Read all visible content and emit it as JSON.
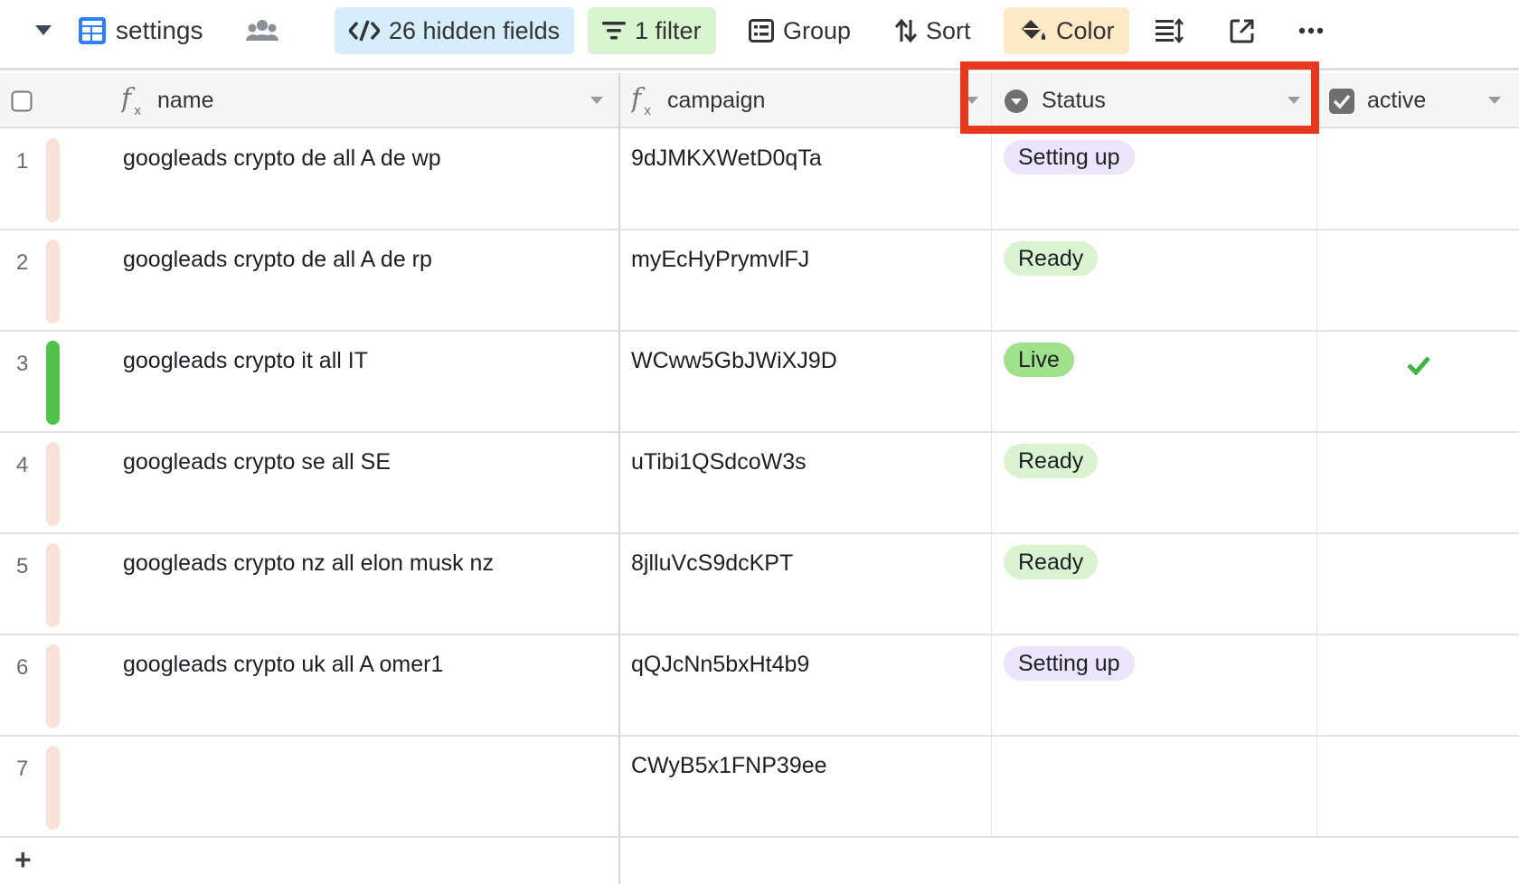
{
  "toolbar": {
    "view_name": "settings",
    "hidden_fields_label": "26 hidden fields",
    "filter_label": "1 filter",
    "group_label": "Group",
    "sort_label": "Sort",
    "color_label": "Color",
    "icons": [
      "chevron-down-icon",
      "grid-view-icon",
      "collaborators-icon",
      "hidden-fields-icon",
      "filter-icon",
      "group-icon",
      "sort-icon",
      "paint-bucket-icon",
      "row-height-icon",
      "share-view-icon",
      "more-icon"
    ]
  },
  "columns": [
    {
      "label": "name",
      "icon": "formula-icon"
    },
    {
      "label": "campaign",
      "icon": "formula-icon"
    },
    {
      "label": "Status",
      "icon": "single-select-icon"
    },
    {
      "label": "active",
      "icon": "checkbox-icon"
    }
  ],
  "rows": [
    {
      "num": "1",
      "name": "googleads crypto de all A  de wp",
      "campaign": "9dJMKXWetD0qTa",
      "status": "Setting up",
      "active": false,
      "color": "#f9e3d8"
    },
    {
      "num": "2",
      "name": "googleads crypto de all A  de rp",
      "campaign": "myEcHyPrymvlFJ",
      "status": "Ready",
      "active": false,
      "color": "#f9e3d8"
    },
    {
      "num": "3",
      "name": "googleads crypto it all   IT",
      "campaign": "WCww5GbJWiXJ9D",
      "status": "Live",
      "active": true,
      "color": "#4fc34a"
    },
    {
      "num": "4",
      "name": "googleads crypto se all   SE",
      "campaign": "uTibi1QSdcoW3s",
      "status": "Ready",
      "active": false,
      "color": "#f9e3d8"
    },
    {
      "num": "5",
      "name": "googleads crypto nz all   elon musk nz",
      "campaign": "8jlluVcS9dcKPT",
      "status": "Ready",
      "active": false,
      "color": "#f9e3d8"
    },
    {
      "num": "6",
      "name": "googleads crypto uk all A  omer1",
      "campaign": "qQJcNn5bxHt4b9",
      "status": "Setting up",
      "active": false,
      "color": "#f9e3d8"
    },
    {
      "num": "7",
      "name": "",
      "campaign": "CWyB5x1FNP39ee",
      "status": "",
      "active": false,
      "color": "#f9e3d8"
    }
  ],
  "status_colors": {
    "Setting up": "#ece4fb",
    "Ready": "#d9f3d0",
    "Live": "#9ee18a"
  },
  "colors": {
    "accent_blue": "#2d7ff9",
    "hidden_fields_bg": "#d6eefc",
    "filter_bg": "#d8f5cf",
    "color_bg": "#fde9c6",
    "highlight": "#e8391f",
    "check_green": "#3fb540"
  },
  "footer": {
    "add_row_label": "+"
  }
}
